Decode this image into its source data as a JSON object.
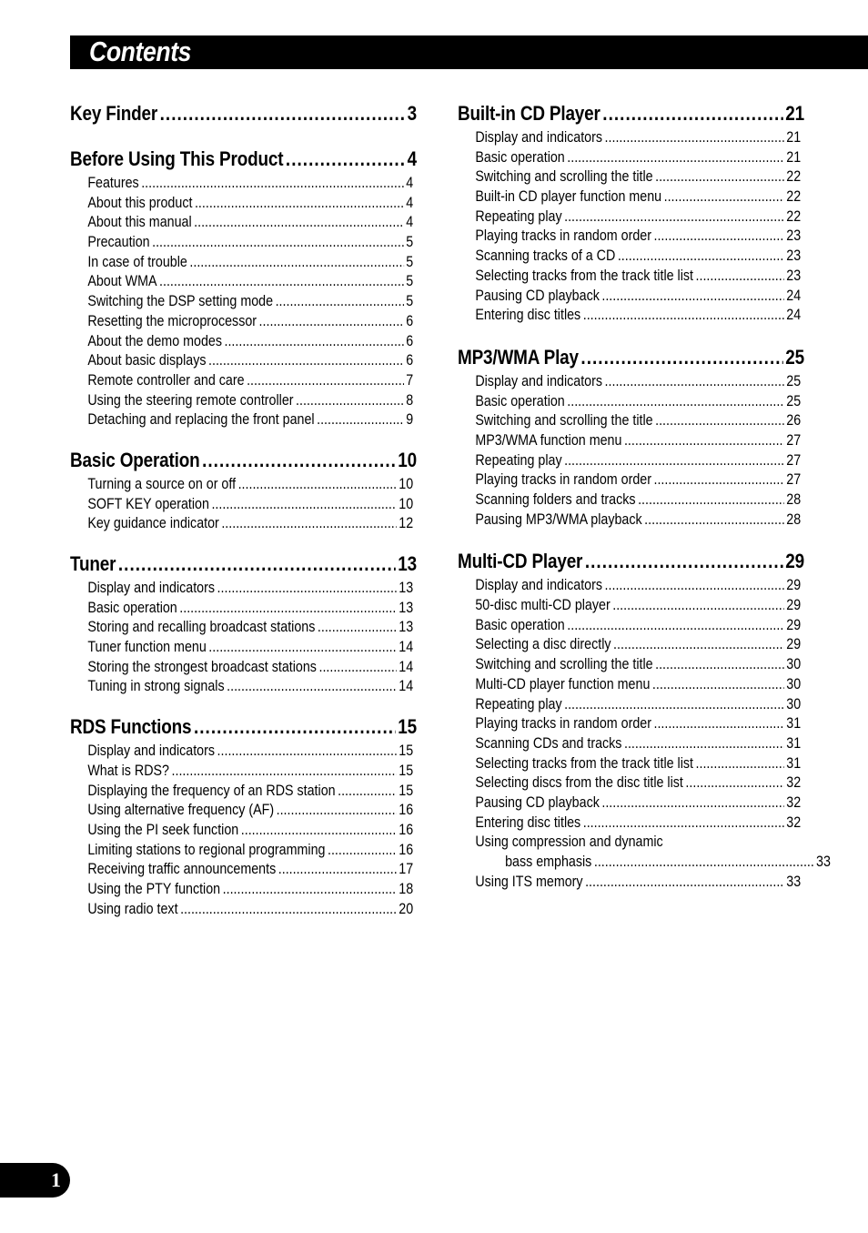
{
  "header": {
    "title": "Contents"
  },
  "page_number": "1",
  "left_column": [
    {
      "title": "Key Finder",
      "page": "3",
      "items": []
    },
    {
      "title": "Before Using This Product",
      "page": "4",
      "items": [
        {
          "label": "Features",
          "page": "4"
        },
        {
          "label": "About this product",
          "page": "4"
        },
        {
          "label": "About this manual",
          "page": "4"
        },
        {
          "label": "Precaution",
          "page": "5"
        },
        {
          "label": "In case of trouble",
          "page": "5"
        },
        {
          "label": "About WMA",
          "page": "5"
        },
        {
          "label": "Switching the DSP setting mode",
          "page": "5"
        },
        {
          "label": "Resetting the microprocessor",
          "page": "6"
        },
        {
          "label": "About the demo modes",
          "page": "6"
        },
        {
          "label": "About basic displays",
          "page": "6"
        },
        {
          "label": "Remote controller and care",
          "page": "7"
        },
        {
          "label": "Using the steering remote controller",
          "page": "8"
        },
        {
          "label": "Detaching and replacing the front panel",
          "page": "9"
        }
      ]
    },
    {
      "title": "Basic Operation",
      "page": "10",
      "items": [
        {
          "label": "Turning a source on or off",
          "page": "10"
        },
        {
          "label": "SOFT KEY operation",
          "page": "10"
        },
        {
          "label": "Key guidance indicator",
          "page": "12"
        }
      ]
    },
    {
      "title": "Tuner",
      "page": "13",
      "items": [
        {
          "label": "Display and indicators",
          "page": "13"
        },
        {
          "label": "Basic operation",
          "page": "13"
        },
        {
          "label": "Storing and recalling broadcast stations",
          "page": "13"
        },
        {
          "label": "Tuner function menu",
          "page": "14"
        },
        {
          "label": "Storing the strongest broadcast stations",
          "page": "14"
        },
        {
          "label": "Tuning in strong signals",
          "page": "14"
        }
      ]
    },
    {
      "title": "RDS Functions",
      "page": "15",
      "items": [
        {
          "label": "Display and indicators",
          "page": "15"
        },
        {
          "label": "What is RDS?",
          "page": "15"
        },
        {
          "label": "Displaying the frequency of an RDS station",
          "page": "15"
        },
        {
          "label": "Using alternative frequency (AF)",
          "page": "16"
        },
        {
          "label": "Using the PI seek function",
          "page": "16"
        },
        {
          "label": "Limiting stations to regional programming",
          "page": "16"
        },
        {
          "label": "Receiving traffic announcements",
          "page": "17"
        },
        {
          "label": "Using the PTY function",
          "page": "18"
        },
        {
          "label": "Using radio text",
          "page": "20"
        }
      ]
    }
  ],
  "right_column": [
    {
      "title": "Built-in CD Player",
      "page": "21",
      "items": [
        {
          "label": "Display and indicators",
          "page": "21"
        },
        {
          "label": "Basic operation",
          "page": "21"
        },
        {
          "label": "Switching and scrolling the title",
          "page": "22"
        },
        {
          "label": "Built-in CD player function menu",
          "page": "22"
        },
        {
          "label": "Repeating play",
          "page": "22"
        },
        {
          "label": "Playing tracks in random order",
          "page": "23"
        },
        {
          "label": "Scanning tracks of a CD",
          "page": "23"
        },
        {
          "label": "Selecting tracks from the track title list",
          "page": "23"
        },
        {
          "label": "Pausing CD playback",
          "page": "24"
        },
        {
          "label": "Entering disc titles",
          "page": "24"
        }
      ]
    },
    {
      "title": "MP3/WMA Play",
      "page": "25",
      "items": [
        {
          "label": "Display and indicators",
          "page": "25"
        },
        {
          "label": "Basic operation",
          "page": "25"
        },
        {
          "label": "Switching and scrolling the title",
          "page": "26"
        },
        {
          "label": "MP3/WMA function menu",
          "page": "27"
        },
        {
          "label": "Repeating play",
          "page": "27"
        },
        {
          "label": "Playing tracks in random order",
          "page": "27"
        },
        {
          "label": "Scanning folders and tracks",
          "page": "28"
        },
        {
          "label": "Pausing MP3/WMA playback",
          "page": "28"
        }
      ]
    },
    {
      "title": "Multi-CD Player",
      "page": "29",
      "items": [
        {
          "label": "Display and indicators",
          "page": "29"
        },
        {
          "label": "50-disc multi-CD player",
          "page": "29"
        },
        {
          "label": "Basic operation",
          "page": "29"
        },
        {
          "label": "Selecting a disc directly",
          "page": "29"
        },
        {
          "label": "Switching and scrolling the title",
          "page": "30"
        },
        {
          "label": "Multi-CD player function menu",
          "page": "30"
        },
        {
          "label": "Repeating play",
          "page": "30"
        },
        {
          "label": "Playing tracks in random order",
          "page": "31"
        },
        {
          "label": "Scanning CDs and tracks",
          "page": "31"
        },
        {
          "label": "Selecting tracks from the track title list",
          "page": "31"
        },
        {
          "label": "Selecting discs from the disc title list",
          "page": "32"
        },
        {
          "label": "Pausing CD playback",
          "page": "32"
        },
        {
          "label": "Entering disc titles",
          "page": "32"
        },
        {
          "label": "Using compression and dynamic",
          "continuation": "bass emphasis",
          "page": "33"
        },
        {
          "label": "Using ITS memory",
          "page": "33"
        }
      ]
    }
  ]
}
